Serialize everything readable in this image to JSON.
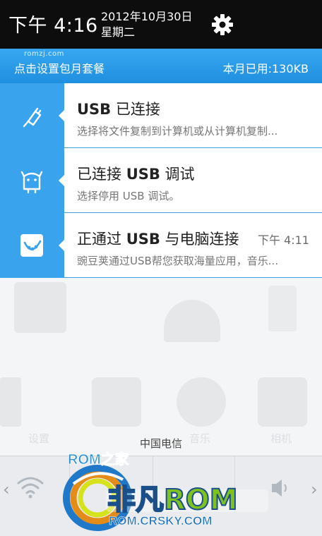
{
  "status_bar": {
    "time": "下午 4:16",
    "date": "2012年10月30日",
    "weekday": "星期二",
    "settings_icon": "gear-icon"
  },
  "plan_bar": {
    "watermark": "romzj.com",
    "setup_label": "点击设置包月套餐",
    "usage_label": "本月已用:130KB"
  },
  "notifications": [
    {
      "icon": "usb-plug-icon",
      "title_bold": "USB",
      "title_rest": " 已连接",
      "text": "选择将文件复制到计算机或从计算机复制...",
      "time": ""
    },
    {
      "icon": "android-debug-icon",
      "title_pre": "已连接 ",
      "title_bold": "USB",
      "title_rest": " 调试",
      "text": "选择停用 USB 调试。",
      "time": ""
    },
    {
      "icon": "wandoujia-pea-icon",
      "title_pre": "正通过 ",
      "title_bold": "USB",
      "title_rest": " 与电脑连接",
      "text": "豌豆荚通过USB帮您获取海量应用，音乐...",
      "time": "下午 4:11"
    }
  ],
  "home_screen": {
    "faded_labels": [
      "设置",
      "音乐",
      "相机"
    ]
  },
  "carrier": "中国电信",
  "quick_toggles": {
    "left_arrow": "‹",
    "right_arrow": "›",
    "items": [
      "wifi-icon",
      "sound-icon"
    ]
  },
  "watermark_logo": {
    "top_text": "ROM之家",
    "main_text": "非凡ROM",
    "url_text": "ROM.CRSKY.COM"
  },
  "colors": {
    "status_bg": "#0d0d0d",
    "accent_blue": "#3aa3ee",
    "notification_bg": "#ffffff"
  }
}
